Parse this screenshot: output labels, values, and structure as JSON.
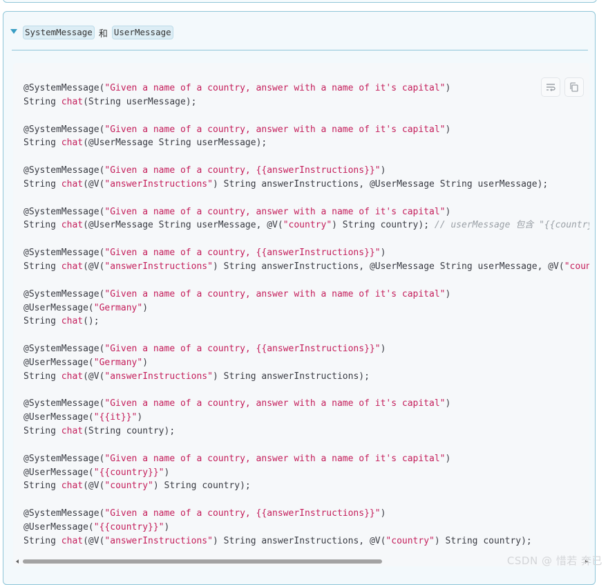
{
  "summary": {
    "code_a": "SystemMessage",
    "conjunction": "和",
    "code_b": "UserMessage"
  },
  "toolbar": {
    "wrap_icon": "wrap-lines-icon",
    "copy_icon": "copy-icon"
  },
  "code_lines": [
    [
      {
        "t": "@SystemMessage("
      },
      {
        "t": "\"Given a name of a country, answer with a name of it's capital\"",
        "c": "str"
      },
      {
        "t": ")"
      }
    ],
    [
      {
        "t": "String "
      },
      {
        "t": "chat",
        "c": "fn"
      },
      {
        "t": "(String userMessage);"
      }
    ],
    [],
    [
      {
        "t": "@SystemMessage("
      },
      {
        "t": "\"Given a name of a country, answer with a name of it's capital\"",
        "c": "str"
      },
      {
        "t": ")"
      }
    ],
    [
      {
        "t": "String "
      },
      {
        "t": "chat",
        "c": "fn"
      },
      {
        "t": "(@UserMessage String userMessage);"
      }
    ],
    [],
    [
      {
        "t": "@SystemMessage("
      },
      {
        "t": "\"Given a name of a country, {{answerInstructions}}\"",
        "c": "str"
      },
      {
        "t": ")"
      }
    ],
    [
      {
        "t": "String "
      },
      {
        "t": "chat",
        "c": "fn"
      },
      {
        "t": "(@V("
      },
      {
        "t": "\"answerInstructions\"",
        "c": "str"
      },
      {
        "t": ") String answerInstructions, @UserMessage String userMessage);"
      }
    ],
    [],
    [
      {
        "t": "@SystemMessage("
      },
      {
        "t": "\"Given a name of a country, answer with a name of it's capital\"",
        "c": "str"
      },
      {
        "t": ")"
      }
    ],
    [
      {
        "t": "String "
      },
      {
        "t": "chat",
        "c": "fn"
      },
      {
        "t": "(@UserMessage String userMessage, @V("
      },
      {
        "t": "\"country\"",
        "c": "str"
      },
      {
        "t": ") String country); "
      },
      {
        "t": "// userMessage 包含 \"{{country}}\"",
        "c": "cm"
      }
    ],
    [],
    [
      {
        "t": "@SystemMessage("
      },
      {
        "t": "\"Given a name of a country, {{answerInstructions}}\"",
        "c": "str"
      },
      {
        "t": ")"
      }
    ],
    [
      {
        "t": "String "
      },
      {
        "t": "chat",
        "c": "fn"
      },
      {
        "t": "(@V("
      },
      {
        "t": "\"answerInstructions\"",
        "c": "str"
      },
      {
        "t": ") String answerInstructions, @UserMessage String userMessage, @V("
      },
      {
        "t": "\"country\"",
        "c": "str"
      }
    ],
    [],
    [
      {
        "t": "@SystemMessage("
      },
      {
        "t": "\"Given a name of a country, answer with a name of it's capital\"",
        "c": "str"
      },
      {
        "t": ")"
      }
    ],
    [
      {
        "t": "@UserMessage("
      },
      {
        "t": "\"Germany\"",
        "c": "str"
      },
      {
        "t": ")"
      }
    ],
    [
      {
        "t": "String "
      },
      {
        "t": "chat",
        "c": "fn"
      },
      {
        "t": "();"
      }
    ],
    [],
    [
      {
        "t": "@SystemMessage("
      },
      {
        "t": "\"Given a name of a country, {{answerInstructions}}\"",
        "c": "str"
      },
      {
        "t": ")"
      }
    ],
    [
      {
        "t": "@UserMessage("
      },
      {
        "t": "\"Germany\"",
        "c": "str"
      },
      {
        "t": ")"
      }
    ],
    [
      {
        "t": "String "
      },
      {
        "t": "chat",
        "c": "fn"
      },
      {
        "t": "(@V("
      },
      {
        "t": "\"answerInstructions\"",
        "c": "str"
      },
      {
        "t": ") String answerInstructions);"
      }
    ],
    [],
    [
      {
        "t": "@SystemMessage("
      },
      {
        "t": "\"Given a name of a country, answer with a name of it's capital\"",
        "c": "str"
      },
      {
        "t": ")"
      }
    ],
    [
      {
        "t": "@UserMessage("
      },
      {
        "t": "\"{{it}}\"",
        "c": "str"
      },
      {
        "t": ")"
      }
    ],
    [
      {
        "t": "String "
      },
      {
        "t": "chat",
        "c": "fn"
      },
      {
        "t": "(String country);"
      }
    ],
    [],
    [
      {
        "t": "@SystemMessage("
      },
      {
        "t": "\"Given a name of a country, answer with a name of it's capital\"",
        "c": "str"
      },
      {
        "t": ")"
      }
    ],
    [
      {
        "t": "@UserMessage("
      },
      {
        "t": "\"{{country}}\"",
        "c": "str"
      },
      {
        "t": ")"
      }
    ],
    [
      {
        "t": "String "
      },
      {
        "t": "chat",
        "c": "fn"
      },
      {
        "t": "(@V("
      },
      {
        "t": "\"country\"",
        "c": "str"
      },
      {
        "t": ") String country);"
      }
    ],
    [],
    [
      {
        "t": "@SystemMessage("
      },
      {
        "t": "\"Given a name of a country, {{answerInstructions}}\"",
        "c": "str"
      },
      {
        "t": ")"
      }
    ],
    [
      {
        "t": "@UserMessage("
      },
      {
        "t": "\"{{country}}\"",
        "c": "str"
      },
      {
        "t": ")"
      }
    ],
    [
      {
        "t": "String "
      },
      {
        "t": "chat",
        "c": "fn"
      },
      {
        "t": "(@V("
      },
      {
        "t": "\"answerInstructions\"",
        "c": "str"
      },
      {
        "t": ") String answerInstructions, @V("
      },
      {
        "t": "\"country\"",
        "c": "str"
      },
      {
        "t": ") String country);"
      }
    ]
  ],
  "watermark": "CSDN @ 惜若 奔已",
  "colors": {
    "accent": "#3a9ec4",
    "string": "#c41d5a",
    "comment": "#9aa0a6",
    "border": "#8fc6d8"
  }
}
